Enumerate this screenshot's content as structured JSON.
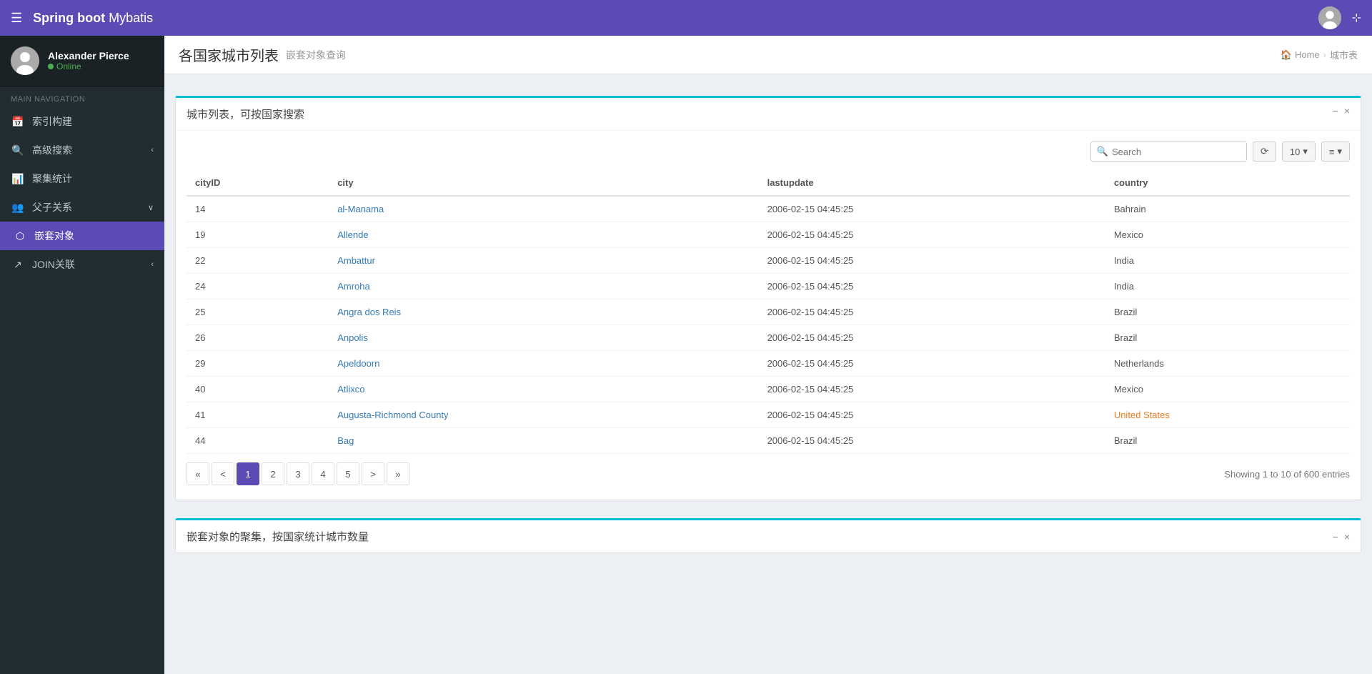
{
  "app": {
    "brand_normal": "Spring boot",
    "brand_bold": "Mybatis"
  },
  "topnav": {
    "hamburger_label": "☰"
  },
  "sidebar": {
    "user": {
      "name": "Alexander Pierce",
      "status": "Online"
    },
    "nav_heading": "MAIN NAVIGATION",
    "items": [
      {
        "id": "index-build",
        "icon": "📅",
        "label": "索引构建",
        "expandable": false
      },
      {
        "id": "advanced-search",
        "icon": "🔍",
        "label": "高级搜索",
        "expandable": true
      },
      {
        "id": "aggregate-stats",
        "icon": "📊",
        "label": "聚集统计",
        "expandable": false
      },
      {
        "id": "parent-child",
        "icon": "👥",
        "label": "父子关系",
        "expandable": true
      },
      {
        "id": "nested-object",
        "icon": "⬡",
        "label": "嵌套对象",
        "expandable": false,
        "active": true
      },
      {
        "id": "join-relation",
        "icon": "🔗",
        "label": "JOIN关联",
        "expandable": true
      }
    ]
  },
  "page": {
    "title": "各国家城市列表",
    "subtitle": "嵌套对象查询",
    "breadcrumb_home": "Home",
    "breadcrumb_current": "城市表"
  },
  "panel1": {
    "header": "城市列表，可按国家搜索",
    "search_placeholder": "Search",
    "per_page_label": "10",
    "columns_label": "≡",
    "refresh_label": "⟳",
    "table_headers": [
      "cityID",
      "city",
      "lastupdate",
      "country"
    ],
    "table_rows": [
      {
        "cityID": "14",
        "city": "al-Manama",
        "lastupdate": "2006-02-15 04:45:25",
        "country": "Bahrain",
        "country_link": false
      },
      {
        "cityID": "19",
        "city": "Allende",
        "lastupdate": "2006-02-15 04:45:25",
        "country": "Mexico",
        "country_link": false
      },
      {
        "cityID": "22",
        "city": "Ambattur",
        "lastupdate": "2006-02-15 04:45:25",
        "country": "India",
        "country_link": false
      },
      {
        "cityID": "24",
        "city": "Amroha",
        "lastupdate": "2006-02-15 04:45:25",
        "country": "India",
        "country_link": false
      },
      {
        "cityID": "25",
        "city": "Angra dos Reis",
        "lastupdate": "2006-02-15 04:45:25",
        "country": "Brazil",
        "country_link": false
      },
      {
        "cityID": "26",
        "city": "Anpolis",
        "lastupdate": "2006-02-15 04:45:25",
        "country": "Brazil",
        "country_link": false
      },
      {
        "cityID": "29",
        "city": "Apeldoorn",
        "lastupdate": "2006-02-15 04:45:25",
        "country": "Netherlands",
        "country_link": false
      },
      {
        "cityID": "40",
        "city": "Atlixco",
        "lastupdate": "2006-02-15 04:45:25",
        "country": "Mexico",
        "country_link": false
      },
      {
        "cityID": "41",
        "city": "Augusta-Richmond County",
        "lastupdate": "2006-02-15 04:45:25",
        "country": "United States",
        "country_link": true
      },
      {
        "cityID": "44",
        "city": "Bag",
        "lastupdate": "2006-02-15 04:45:25",
        "country": "Brazil",
        "country_link": false
      }
    ],
    "pagination": {
      "first": "«",
      "prev": "<",
      "pages": [
        "1",
        "2",
        "3",
        "4",
        "5"
      ],
      "next": ">",
      "last": "»",
      "active_page": "1",
      "info": "Showing 1 to 10 of 600 entries"
    }
  },
  "panel2": {
    "header": "嵌套对象的聚集，按国家统计城市数量",
    "minimize_label": "−",
    "close_label": "×"
  },
  "panel1_controls": {
    "minimize_label": "−",
    "close_label": "×"
  }
}
